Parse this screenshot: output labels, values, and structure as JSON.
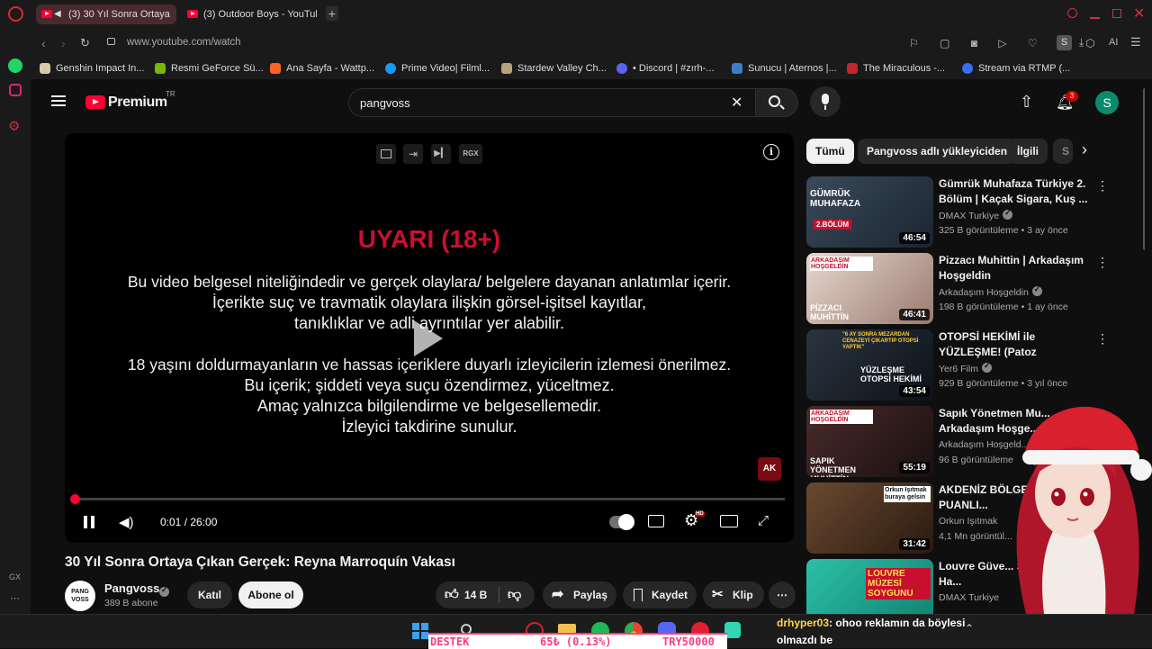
{
  "browser": {
    "tabs": [
      {
        "title": "(3) 30 Yıl Sonra Ortaya",
        "active": true
      },
      {
        "title": "(3) Outdoor Boys - YouTub",
        "active": false
      }
    ],
    "new_tab": "+",
    "url": "www.youtube.com/watch",
    "toolbar_profile": "S",
    "toolbar_ai": "AI",
    "bookmarks": [
      {
        "label": "Genshin Impact In...",
        "color": "#d8c9a8"
      },
      {
        "label": "Resmi GeForce Sü...",
        "color": "#76b900"
      },
      {
        "label": "Ana Sayfa - Wattp...",
        "color": "#ff6122"
      },
      {
        "label": "Prime Video| Filml...",
        "color": "#1399ff"
      },
      {
        "label": "Stardew Valley Ch...",
        "color": "#b9a27a"
      },
      {
        "label": "• Discord | #zırh-...",
        "color": "#5865f2"
      },
      {
        "label": "Sunucu | Aternos |...",
        "color": "#3c7ec9"
      },
      {
        "label": "The Miraculous -...",
        "color": "#c0262d"
      },
      {
        "label": "Stream via RTMP (...",
        "color": "#3a6df0"
      }
    ],
    "sidebar_bottom": "GX"
  },
  "youtube": {
    "logo_text": "Premium",
    "logo_region": "TR",
    "search_value": "pangvoss",
    "notif_count": "3",
    "avatar_letter": "S",
    "player": {
      "warning_title": "UYARI (18+)",
      "warning_lines": [
        "Bu video belgesel niteliğindedir ve gerçek olaylara/ belgelere dayanan anlatımlar içerir.",
        "İçerikte suç ve travmatik olaylara ilişkin görsel-işitsel kayıtlar,",
        "tanıklıklar ve adli ayrıntılar yer alabilir.",
        "18 yaşını doldurmayanların ve hassas içeriklere duyarlı izleyicilerin izlemesi önerilmez.",
        "Bu içerik; şiddeti veya suçu özendirmez, yüceltmez.",
        "Amaç yalnızca bilgilendirme ve belgesellemedir.",
        "İzleyici takdirine sunulur."
      ],
      "time": "0:01 / 26:00",
      "progress": 0.0006,
      "top_badge": "RGX",
      "hd_badge": "HD",
      "watermark": "AK"
    },
    "video_title": "30 Yıl Sonra Ortaya Çıkan Gerçek: Reyna Marroquín Vakası",
    "channel": {
      "name": "Pangvoss",
      "subs": "389 B abone",
      "avatar_text": "PANG VOSS",
      "join": "Katıl",
      "subscribe": "Abone ol"
    },
    "actions": {
      "likes": "14 B",
      "share": "Paylaş",
      "save": "Kaydet",
      "clip": "Klip"
    },
    "chips": [
      "Tümü",
      "Pangvoss adlı yükleyiciden",
      "İlgili",
      "S"
    ],
    "recommendations": [
      {
        "title": "Gümrük Muhafaza Türkiye 2. Bölüm | Kaçak Sigara, Kuş ...",
        "channel": "DMAX Turkiye",
        "meta": "325 B görüntüleme • 3 ay önce",
        "duration": "46:54",
        "thumb_text": "GÜMRÜK MUHAFAZA",
        "thumb_sub": "2.BÖLÜM",
        "color": "#2a3a4a"
      },
      {
        "title": "Pizzacı Muhittin | Arkadaşım Hoşgeldin",
        "channel": "Arkadaşım Hoşgeldin",
        "meta": "198 B görüntüleme • 1 ay önce",
        "duration": "46:41",
        "thumb_text": "PİZZACI MUHİTTİN",
        "thumb_sub": "ARKADAŞIM HOŞGELDİN",
        "color": "#c8b9b0"
      },
      {
        "title": "OTOPSİ HEKİMİ ile YÜZLEŞME! (Patoz Makinesinden Geçmiş ...",
        "channel": "Yer6 Film",
        "meta": "929 B görüntüleme • 3 yıl önce",
        "duration": "43:54",
        "thumb_text": "YÜZLEŞME OTOPSİ HEKİMİ",
        "thumb_sub": "\"6 AY SONRA MEZARDAN CENAZEYİ ÇIKARTIP OTOPSİ YAPTIK\"",
        "color": "#1f2530"
      },
      {
        "title": "Sapık Yönetmen Mu... Arkadaşım Hoşge...",
        "channel": "Arkadaşım Hoşgeld...",
        "meta": "96 B görüntüleme",
        "duration": "55:19",
        "thumb_text": "SAPIK YÖNETMEN MUHİTTİN",
        "thumb_sub": "ARKADAŞIM HOŞGELDİN",
        "color": "#3a2a2a"
      },
      {
        "title": "AKDENİZ BÖLGE... DÜŞÜK PUANLI...",
        "channel": "Orkun Işıtmak",
        "meta": "4,1 Mn görüntül...",
        "duration": "31:42",
        "thumb_text": "Orkun Işıtmak buraya gelsin",
        "thumb_sub": "",
        "color": "#4a3a30"
      },
      {
        "title": "Louvre Güve... Şok Edici Ha...",
        "channel": "DMAX Turkiye",
        "meta": "",
        "duration": "",
        "thumb_text": "LOUVRE MÜZESİ SOYGUNU",
        "thumb_sub": "",
        "color": "#1aa890"
      }
    ]
  },
  "stream_overlay": {
    "ticker_left": "DESTEK",
    "ticker_mid": "65₺ (0.13%)",
    "ticker_right": "TRY50000",
    "chat_user": "drhyper03",
    "chat_text": ": ohoo reklamın da böylesi olmazdı be"
  },
  "colors": {
    "warning_red": "#c8102e",
    "progress_red": "#ff0033",
    "youtube_red": "#ff0033",
    "avatar_green": "#0b8a6e",
    "ticker_pink": "#ff3b7a"
  }
}
